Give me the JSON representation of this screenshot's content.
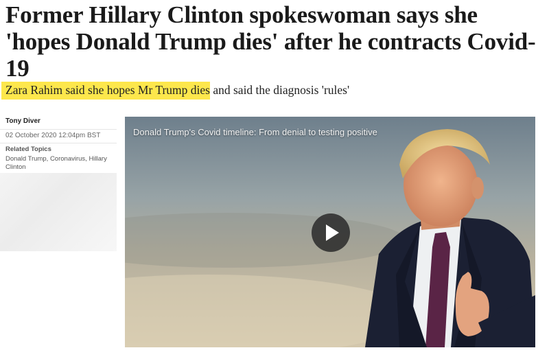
{
  "article": {
    "headline": "Former Hillary Clinton spokeswoman says she 'hopes Donald Trump dies' after he contracts Covid-19",
    "standfirst_highlight": "Zara Rahim said she hopes Mr Trump dies",
    "standfirst_rest": " and said the diagnosis 'rules'",
    "author": "Tony Diver",
    "date": "02 October 2020 12:04pm BST",
    "related_topics_label": "Related Topics",
    "related_topics": "Donald Trump, Coronavirus, Hillary Clinton"
  },
  "video": {
    "title": "Donald Trump's Covid timeline: From denial to testing positive",
    "play_icon": "play-icon"
  },
  "colors": {
    "highlight": "#fde74c",
    "text": "#1a1a1a"
  }
}
